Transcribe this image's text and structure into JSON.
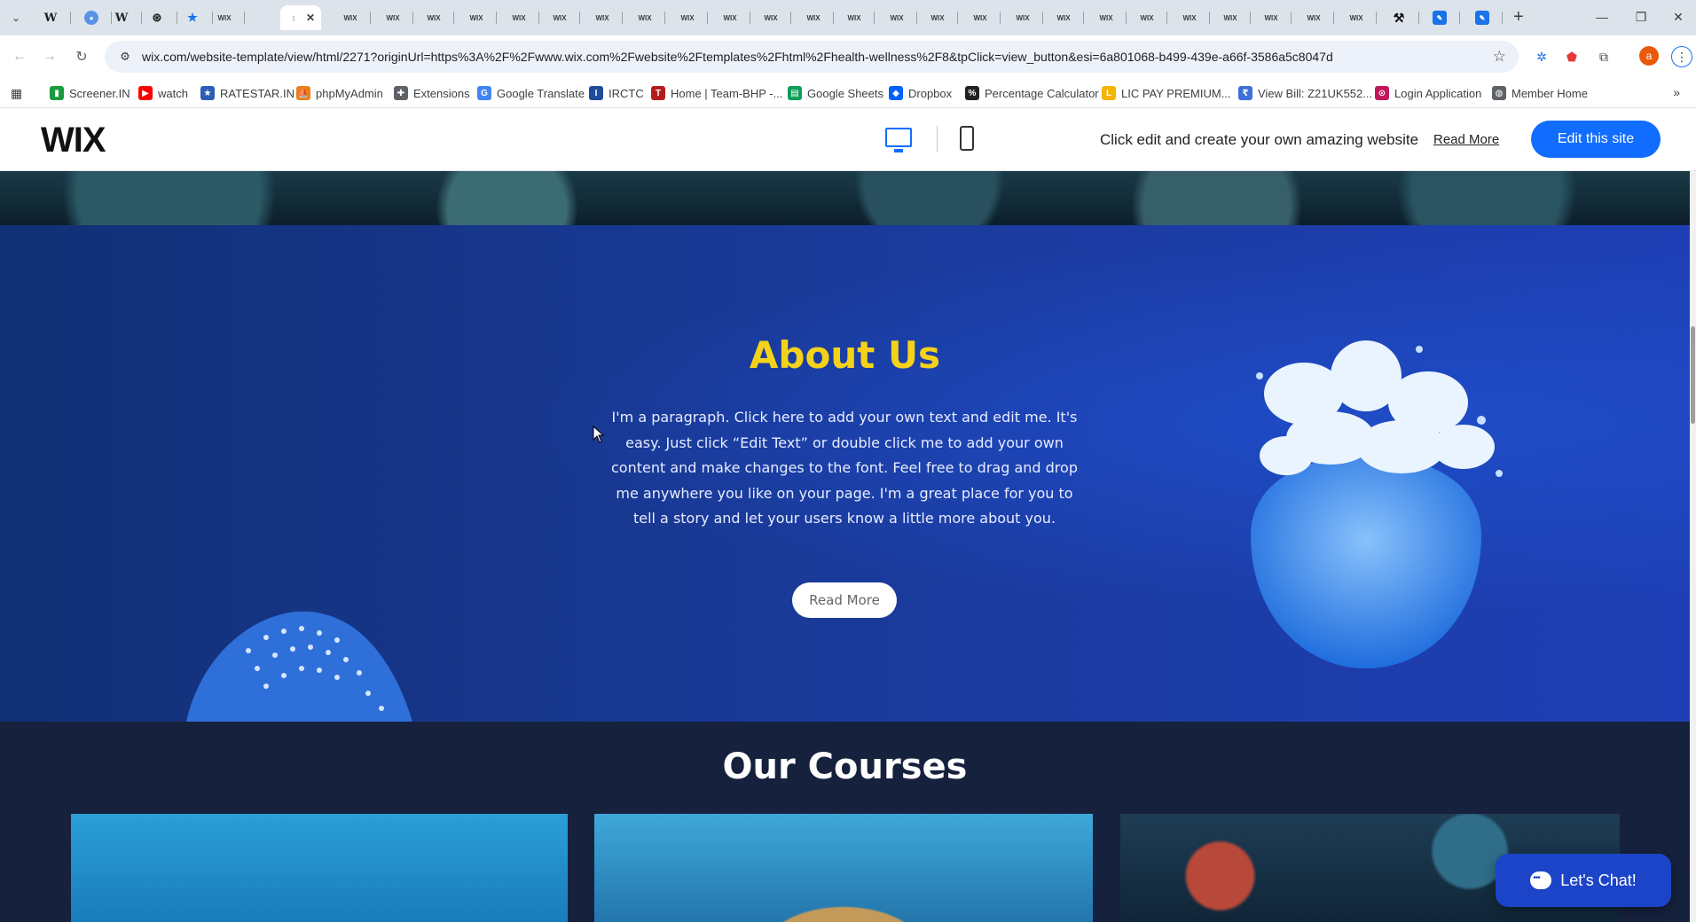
{
  "browser": {
    "active_tab_close": "✕",
    "new_tab": "+",
    "url": "wix.com/website-template/view/html/2271?originUrl=https%3A%2F%2Fwww.wix.com%2Fwebsite%2Ftemplates%2Fhtml%2Fhealth-wellness%2F8&tpClick=view_button&esi=6a801068-b499-439e-a66f-3586a5c8047d",
    "window_controls": {
      "minimize": "—",
      "restore": "❐",
      "close": "✕"
    },
    "bookmarks": [
      {
        "label": "Screener.IN",
        "icon": "bar-chart-icon",
        "color": "#1a9c3e"
      },
      {
        "label": "watch",
        "icon": "youtube-icon",
        "color": "#ff0000"
      },
      {
        "label": "RATESTAR.IN",
        "icon": "ratestar-icon",
        "color": "#2c5fb3"
      },
      {
        "label": "phpMyAdmin",
        "icon": "phpmyadmin-icon",
        "color": "#e8811d"
      },
      {
        "label": "Extensions",
        "icon": "puzzle-icon",
        "color": "#5f6368"
      },
      {
        "label": "Google Translate",
        "icon": "translate-icon",
        "color": "#4285f4"
      },
      {
        "label": "IRCTC",
        "icon": "irctc-icon",
        "color": "#1e4c9a"
      },
      {
        "label": "Home | Team-BHP -...",
        "icon": "teambhp-icon",
        "color": "#b51d1d"
      },
      {
        "label": "Google Sheets",
        "icon": "sheets-icon",
        "color": "#0f9d58"
      },
      {
        "label": "Dropbox",
        "icon": "dropbox-icon",
        "color": "#0061fe"
      },
      {
        "label": "Percentage Calculator",
        "icon": "percent-icon",
        "color": "#222222"
      },
      {
        "label": "LIC PAY PREMIUM...",
        "icon": "lic-icon",
        "color": "#f4b400"
      },
      {
        "label": "View Bill: Z21UK552...",
        "icon": "bill-icon",
        "color": "#3f6fd8"
      },
      {
        "label": "Login Application",
        "icon": "login-icon",
        "color": "#c2185b"
      },
      {
        "label": "Member Home",
        "icon": "globe-icon",
        "color": "#5f6368"
      }
    ]
  },
  "wix_bar": {
    "logo": "WIX",
    "message": "Click edit and create your own amazing website",
    "read_more": "Read More",
    "edit_button": "Edit this site"
  },
  "about": {
    "title": "About Us",
    "paragraph": "I'm a paragraph. Click here to add your own text and edit me. It's easy. Just click “Edit Text” or double click me to add your own content and make changes to the font. Feel free to drag and drop me anywhere you like on your page. I'm a great place for you to tell a story and let your users know a little more about you.",
    "button": "Read More"
  },
  "courses": {
    "title": "Our Courses"
  },
  "chat": {
    "label": "Let's Chat!"
  },
  "colors": {
    "accent": "#116dff",
    "title_yellow": "#f5d21a",
    "about_bg": "#1a3a9a",
    "courses_bg": "#16213d",
    "chat_bg": "#1c44c8"
  }
}
